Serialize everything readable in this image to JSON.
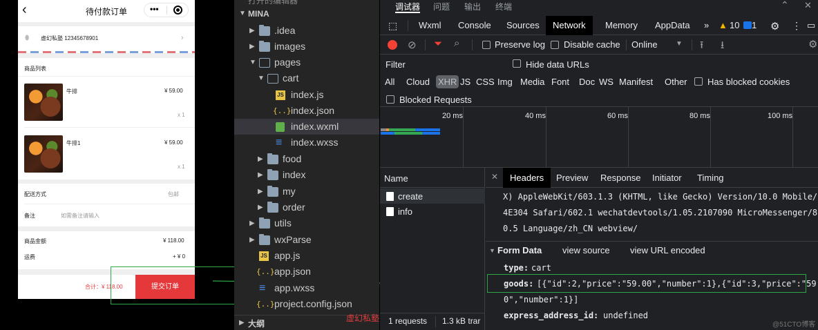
{
  "phone": {
    "title": "待付款订单",
    "back_icon": "chevron-left-icon",
    "menu_dots": "•••",
    "address": "虚幻私塾 12345678901",
    "goods_list_label": "商品列表",
    "items": [
      {
        "name": "牛排",
        "price": "¥ 59.00",
        "qty": "x 1"
      },
      {
        "name": "牛排1",
        "price": "¥ 59.00",
        "qty": "x 1"
      }
    ],
    "delivery_label": "配送方式",
    "delivery_value": "包邮",
    "remark_label": "备注",
    "remark_placeholder": "如需备注请输入",
    "amount_label": "商品金额",
    "amount_value": "¥ 118.00",
    "freight_label": "运费",
    "freight_value": "+ ¥ 0",
    "total_label": "合计：¥ 118.00",
    "submit_label": "提交订单"
  },
  "explorer": {
    "header_partial": "打开的编辑器",
    "root": "MINA",
    "items": [
      {
        "label": ".idea",
        "icon": "folder-icon"
      },
      {
        "label": "images",
        "icon": "folder-icon"
      },
      {
        "label": "pages",
        "icon": "folder-open-icon"
      },
      {
        "label": "cart",
        "icon": "folder-open-icon"
      },
      {
        "label": "index.js",
        "icon": "js-file-icon"
      },
      {
        "label": "index.json",
        "icon": "json-file-icon"
      },
      {
        "label": "index.wxml",
        "icon": "wxml-file-icon"
      },
      {
        "label": "index.wxss",
        "icon": "wxss-file-icon"
      },
      {
        "label": "food",
        "icon": "folder-icon"
      },
      {
        "label": "index",
        "icon": "folder-icon"
      },
      {
        "label": "my",
        "icon": "folder-icon"
      },
      {
        "label": "order",
        "icon": "folder-icon"
      },
      {
        "label": "utils",
        "icon": "folder-icon"
      },
      {
        "label": "wxParse",
        "icon": "folder-icon"
      },
      {
        "label": "app.js",
        "icon": "js-file-icon"
      },
      {
        "label": "app.json",
        "icon": "json-file-icon"
      },
      {
        "label": "app.wxss",
        "icon": "wxss-file-icon"
      },
      {
        "label": "project.config.json",
        "icon": "json-file-icon"
      }
    ],
    "outline": "大纲",
    "watermark": "虚幻私塾：xuhss.com"
  },
  "devtools": {
    "top_tabs": [
      "调试器",
      "问题",
      "输出",
      "终端"
    ],
    "tabs": [
      "Wxml",
      "Console",
      "Sources",
      "Network",
      "Memory",
      "AppData"
    ],
    "active_tab": "Network",
    "warning_count": "10",
    "message_count": "1",
    "preserve_log": "Preserve log",
    "disable_cache": "Disable cache",
    "throttling": "Online",
    "filter_placeholder": "Filter",
    "hide_data_urls": "Hide data URLs",
    "type_filters": [
      "All",
      "Cloud",
      "XHR",
      "JS",
      "CSS",
      "Img",
      "Media",
      "Font",
      "Doc",
      "WS",
      "Manifest",
      "Other"
    ],
    "active_type": "XHR",
    "has_blocked_cookies": "Has blocked cookies",
    "blocked_requests": "Blocked Requests",
    "timeline_ticks": [
      "20 ms",
      "40 ms",
      "60 ms",
      "80 ms",
      "100 ms"
    ],
    "name_header": "Name",
    "requests": [
      "create",
      "info"
    ],
    "status": "1 requests",
    "transferred": "1.3 kB trar",
    "detail_tabs": [
      "Headers",
      "Preview",
      "Response",
      "Initiator",
      "Timing"
    ],
    "active_detail_tab": "Headers",
    "ua_lines": [
      "X) AppleWebKit/603.1.3 (KHTML, like Gecko) Version/10.0 Mobile/1",
      "4E304 Safari/602.1 wechatdevtools/1.05.2107090 MicroMessenger/8.",
      "0.5 Language/zh_CN webview/"
    ],
    "form_data_label": "Form Data",
    "view_source": "view source",
    "view_url_encoded": "view URL encoded",
    "fields": {
      "type_key": "type:",
      "type_value": "cart",
      "goods_key": "goods:",
      "goods_value_1": "[{\"id\":2,\"price\":\"59.00\",\"number\":1},{\"id\":3,\"price\":\"59.0",
      "goods_value_2": "0\",\"number\":1}]",
      "express_key": "express_address_id:",
      "express_value": "undefined"
    },
    "corner_watermark": "@51CTO博客"
  }
}
